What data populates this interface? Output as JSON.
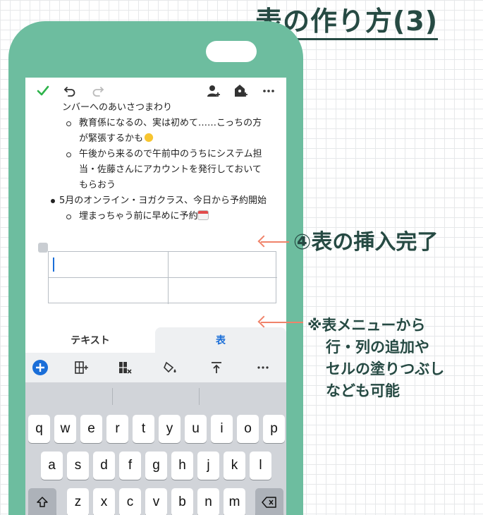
{
  "title": "表の作り方(3)",
  "toolbar": {
    "icons": [
      "checkmark-icon",
      "undo-icon",
      "redo-icon",
      "add-person-icon",
      "share-icon",
      "more-icon"
    ]
  },
  "note": {
    "lines": [
      "ンバーへのあいさつまわり",
      "教育係になるの、実は初めて……こっちの方",
      "が緊張するかも",
      "午後から来るので午前中のうちにシステム担",
      "当・佐藤さんにアカウントを発行しておいて",
      "もらおう",
      "5月のオンライン・ヨガクラス、今日から予約開始",
      "埋まっちゃう前に早めに予約"
    ]
  },
  "tabs": {
    "text": "テキスト",
    "table": "表"
  },
  "format_bar": {
    "icons": [
      "add-icon",
      "insert-column-icon",
      "delete-column-icon",
      "fill-color-icon",
      "align-top-icon",
      "more-icon"
    ]
  },
  "keyboard": {
    "row1": [
      "q",
      "w",
      "e",
      "r",
      "t",
      "y",
      "u",
      "i",
      "o",
      "p"
    ],
    "row2": [
      "a",
      "s",
      "d",
      "f",
      "g",
      "h",
      "j",
      "k",
      "l"
    ],
    "row3": [
      "z",
      "x",
      "c",
      "v",
      "b",
      "n",
      "m"
    ]
  },
  "annotations": {
    "main": "④表の挿入完了",
    "note_lines": [
      "※表メニューから",
      "行・列の追加や",
      "セルの塗りつぶし",
      "なども可能"
    ]
  },
  "colors": {
    "phone": "#6dbd9f",
    "accent": "#1a6ed8",
    "arrow": "#f0836a",
    "title": "#264a43"
  }
}
